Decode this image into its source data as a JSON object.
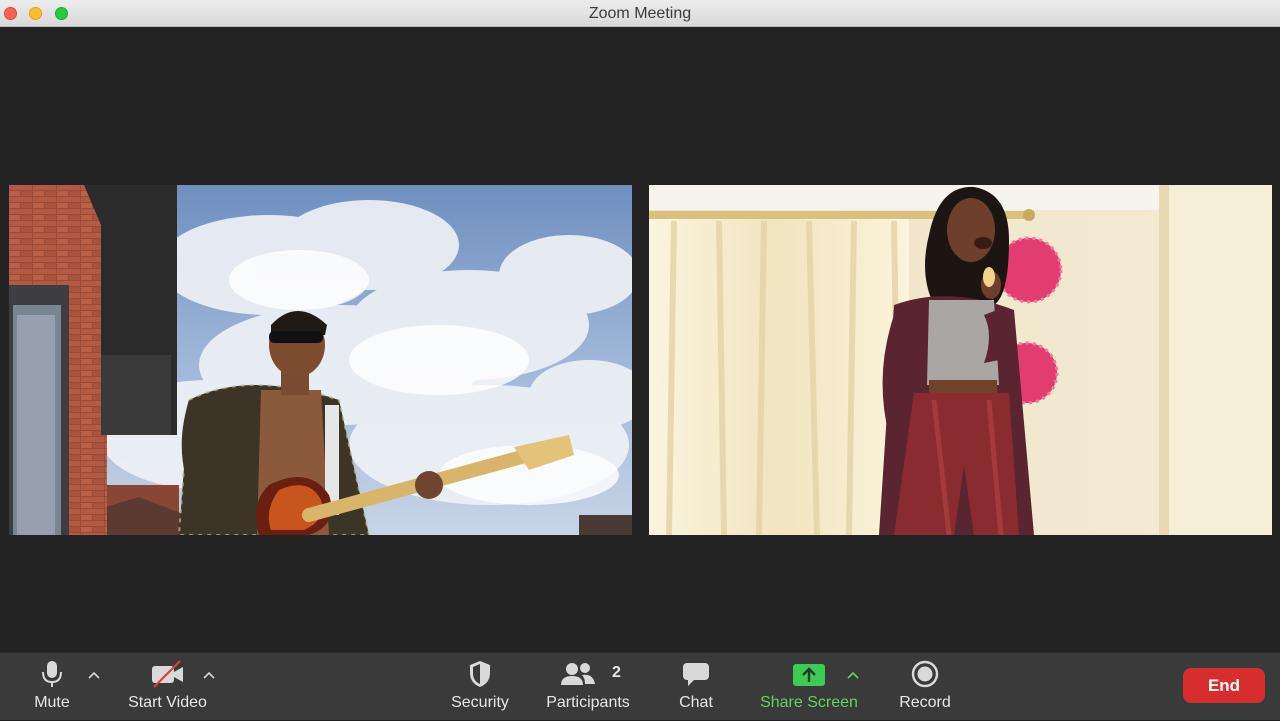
{
  "window": {
    "title": "Zoom Meeting"
  },
  "toolbar": {
    "mute_label": "Mute",
    "start_video_label": "Start Video",
    "security_label": "Security",
    "participants_label": "Participants",
    "participants_count": "2",
    "chat_label": "Chat",
    "share_screen_label": "Share Screen",
    "record_label": "Record",
    "end_label": "End"
  },
  "colors": {
    "end_button": "#d62e2e",
    "share_screen_accent": "#5fd35f",
    "toolbar_bg": "#3a3a3a",
    "stage_bg": "#232323"
  }
}
